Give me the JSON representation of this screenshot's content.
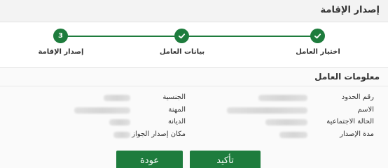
{
  "header": {
    "title": "إصدار الإقامة"
  },
  "stepper": {
    "steps": [
      {
        "label": "اختيار العامل",
        "state": "done",
        "marker": ""
      },
      {
        "label": "بيانات العامل",
        "state": "done",
        "marker": ""
      },
      {
        "label": "إصدار الإقامة",
        "state": "current",
        "marker": "3"
      }
    ],
    "accent_color": "#1e7c3d"
  },
  "worker_info": {
    "title": "معلومات العامل",
    "right_fields": [
      {
        "label": "رقم الحدود"
      },
      {
        "label": "الاسم"
      },
      {
        "label": "الحالة الاجتماعية"
      },
      {
        "label": "مدة الإصدار"
      }
    ],
    "left_fields": [
      {
        "label": "الجنسية"
      },
      {
        "label": "المهنة"
      },
      {
        "label": "الديانة"
      },
      {
        "label": "مكان إصدار الجواز"
      }
    ]
  },
  "actions": {
    "confirm_label": "تأكيد",
    "back_label": "عودة"
  }
}
